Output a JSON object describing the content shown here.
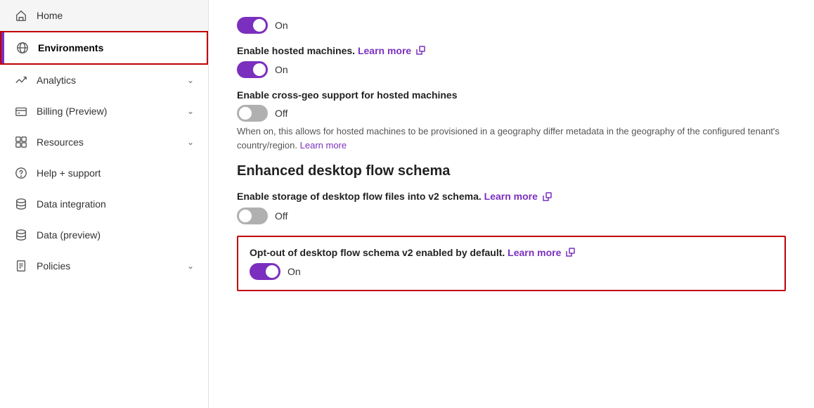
{
  "sidebar": {
    "items": [
      {
        "id": "home",
        "label": "Home",
        "icon": "home",
        "active": false,
        "chevron": false
      },
      {
        "id": "environments",
        "label": "Environments",
        "icon": "globe",
        "active": true,
        "chevron": false
      },
      {
        "id": "analytics",
        "label": "Analytics",
        "icon": "analytics",
        "active": false,
        "chevron": true
      },
      {
        "id": "billing",
        "label": "Billing (Preview)",
        "icon": "billing",
        "active": false,
        "chevron": true
      },
      {
        "id": "resources",
        "label": "Resources",
        "icon": "resources",
        "active": false,
        "chevron": true
      },
      {
        "id": "help-support",
        "label": "Help + support",
        "icon": "help",
        "active": false,
        "chevron": false
      },
      {
        "id": "data-integration",
        "label": "Data integration",
        "icon": "data-integration",
        "active": false,
        "chevron": false
      },
      {
        "id": "data-preview",
        "label": "Data (preview)",
        "icon": "data-preview",
        "active": false,
        "chevron": false
      },
      {
        "id": "policies",
        "label": "Policies",
        "icon": "policies",
        "active": false,
        "chevron": true
      }
    ]
  },
  "main": {
    "toggle1": {
      "state": "on",
      "label": "On"
    },
    "hosted_machines": {
      "setting_label": "Enable hosted machines.",
      "learn_more": "Learn more",
      "toggle_state": "on",
      "toggle_label": "On"
    },
    "cross_geo": {
      "setting_label": "Enable cross-geo support for hosted machines",
      "toggle_state": "off",
      "toggle_label": "Off",
      "description": "When on, this allows for hosted machines to be provisioned in a geography differ metadata in the geography of the configured tenant's country/region.",
      "learn_more": "Learn more"
    },
    "enhanced_schema": {
      "section_title": "Enhanced desktop flow schema",
      "storage_setting": {
        "label": "Enable storage of desktop flow files into v2 schema.",
        "learn_more": "Learn more",
        "toggle_state": "off",
        "toggle_label": "Off"
      },
      "opt_out_setting": {
        "label": "Opt-out of desktop flow schema v2 enabled by default.",
        "learn_more": "Learn more",
        "toggle_state": "on",
        "toggle_label": "On"
      }
    }
  }
}
